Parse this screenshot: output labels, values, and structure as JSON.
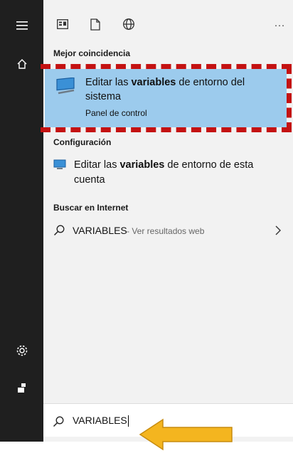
{
  "sections": {
    "best_match": "Mejor coincidencia",
    "settings": "Configuración",
    "internet": "Buscar en Internet"
  },
  "best_match": {
    "title_prefix": "Editar las ",
    "title_bold": "variables",
    "title_suffix": " de entorno del sistema",
    "subtitle": "Panel de control"
  },
  "settings_item": {
    "prefix": "Editar las ",
    "bold": "variables",
    "suffix": " de entorno de esta cuenta"
  },
  "web_item": {
    "query": "VARIABLES",
    "suffix": " - Ver resultados web"
  },
  "search": {
    "value": "VARIABLES"
  },
  "toolbar": {
    "more_label": "···"
  },
  "icons": [
    "menu-icon",
    "home-icon",
    "settings-icon",
    "user-icon",
    "apps-icon",
    "document-icon",
    "web-icon",
    "search-icon",
    "chevron-right-icon"
  ],
  "colors": {
    "rail": "#1f1f1f",
    "highlight": "#9ccbed",
    "annotation_dashed": "#c41212",
    "annotation_arrow": "#f4b51f"
  }
}
